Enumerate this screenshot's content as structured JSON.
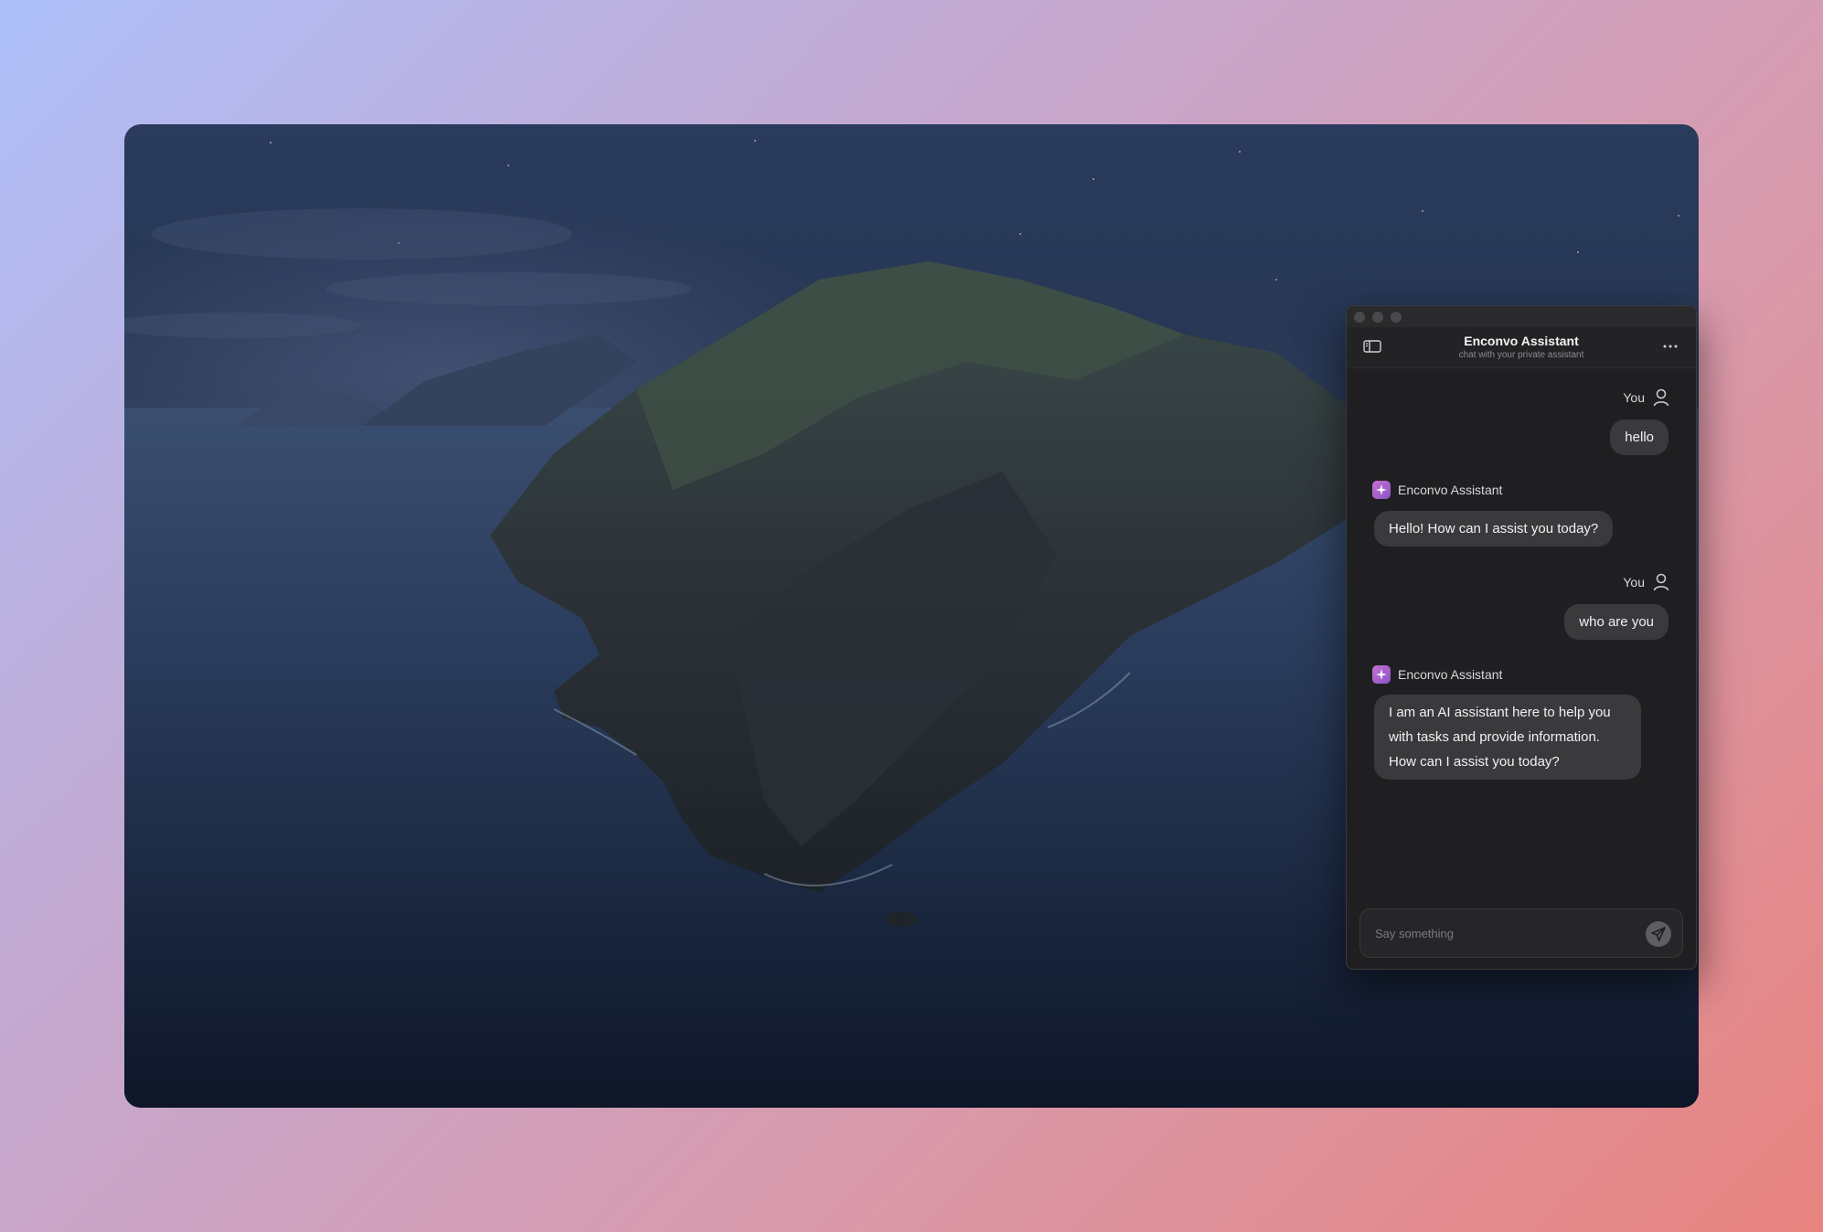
{
  "window": {
    "title": "Enconvo Assistant",
    "subtitle": "chat with your private assistant"
  },
  "icons": {
    "sidebar": "sidebar-toggle-icon",
    "more": "more-horizontal-icon",
    "user": "user-icon",
    "assistant": "sparkle-icon",
    "send": "send-icon"
  },
  "messages": [
    {
      "sender": "You",
      "role": "user",
      "text": "hello"
    },
    {
      "sender": "Enconvo Assistant",
      "role": "assistant",
      "text": "Hello! How can I assist you today?"
    },
    {
      "sender": "You",
      "role": "user",
      "text": "who are you"
    },
    {
      "sender": "Enconvo Assistant",
      "role": "assistant",
      "text": "I am an AI assistant here to help you with tasks and provide information. How can I assist you today?"
    }
  ],
  "composer": {
    "placeholder": "Say something",
    "value": ""
  },
  "colors": {
    "window_bg": "#1f1f21",
    "bubble_bg": "#3a3a3d",
    "assistant_accent": "#b764cf"
  }
}
